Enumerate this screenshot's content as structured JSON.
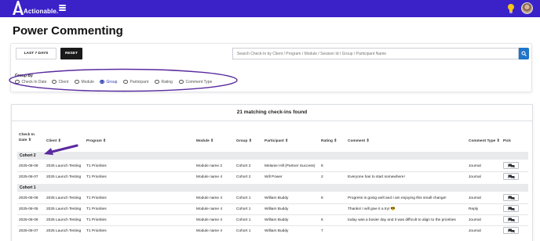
{
  "app": {
    "brand": "Actionable."
  },
  "page": {
    "title": "Power Commenting"
  },
  "filters": {
    "last7_label": "LAST 7 DAYS",
    "reset_label": "RESET",
    "search_placeholder": "Search Check-In by Client / Program / Module / Session Id / Group / Participant Name",
    "group_by_label": "Group By",
    "group_by_options": [
      "Check-In Date",
      "Client",
      "Module",
      "Group",
      "Participant",
      "Rating",
      "Comment Type"
    ],
    "group_by_selected": "Group"
  },
  "results": {
    "count_text": "21 matching check-ins found",
    "columns": {
      "date_line1": "Check In",
      "date_line2": "Date ⇕",
      "client": "Client ⇕",
      "program": "Program ⇕",
      "module": "Module ⇕",
      "group": "Group ⇕",
      "participant": "Participant ⇕",
      "rating": "Rating ⇕",
      "comment": "Comment ⇕",
      "comment_type": "Comment Type ⇕",
      "pick": "Pick"
    },
    "groups": [
      {
        "name": "Cohort 2",
        "rows": [
          {
            "date": "2025-08-08",
            "client": "2025 Launch Testing",
            "program": "T1 Priorities",
            "module": "Module name 2",
            "group": "Cohort 2",
            "participant": "Melanie Hill (Partner Success)",
            "rating": "8",
            "comment": "",
            "comment_type": "Journal"
          },
          {
            "date": "2025-08-07",
            "client": "2025 Launch Testing",
            "program": "T1 Priorities",
            "module": "Module name 4",
            "group": "Cohort 2",
            "participant": "Will Power",
            "rating": "2",
            "comment": "Everyone has to start somewhere!",
            "comment_type": "Journal"
          }
        ]
      },
      {
        "name": "Cohort 1",
        "rows": [
          {
            "date": "2025-08-08",
            "client": "2025 Launch Testing",
            "program": "T1 Priorities",
            "module": "Module name 4",
            "group": "Cohort 1",
            "participant": "William Buddy",
            "rating": "8",
            "comment": "Progress is going well and I am enjoying this small change!",
            "comment_type": "Journal"
          },
          {
            "date": "2025-08-05",
            "client": "2025 Launch Testing",
            "program": "T1 Priorities",
            "module": "Module name 4",
            "group": "Cohort 1",
            "participant": "William Buddy",
            "rating": "",
            "comment": "Thanks! I will give it a try! 😎",
            "comment_type": "Reply"
          },
          {
            "date": "2025-08-06",
            "client": "2025 Launch Testing",
            "program": "T1 Priorities",
            "module": "Module name 4",
            "group": "Cohort 1",
            "participant": "William Buddy",
            "rating": "6",
            "comment": "today was a busier day and it was difficult to align to the priorities",
            "comment_type": "Journal"
          },
          {
            "date": "2025-08-07",
            "client": "2025 Launch Testing",
            "program": "T1 Priorities",
            "module": "Module name 4",
            "group": "Cohort 1",
            "participant": "William Buddy",
            "rating": "7",
            "comment": "",
            "comment_type": "Journal"
          }
        ]
      }
    ]
  },
  "colors": {
    "nav": "#3a22c8",
    "annotation": "#5a2a9e",
    "search_button": "#1f75c9"
  },
  "icons": {
    "menu": "hamburger-icon",
    "tip": "lightbulb-icon",
    "search": "search-icon",
    "pick": "chat-bubbles-icon"
  }
}
